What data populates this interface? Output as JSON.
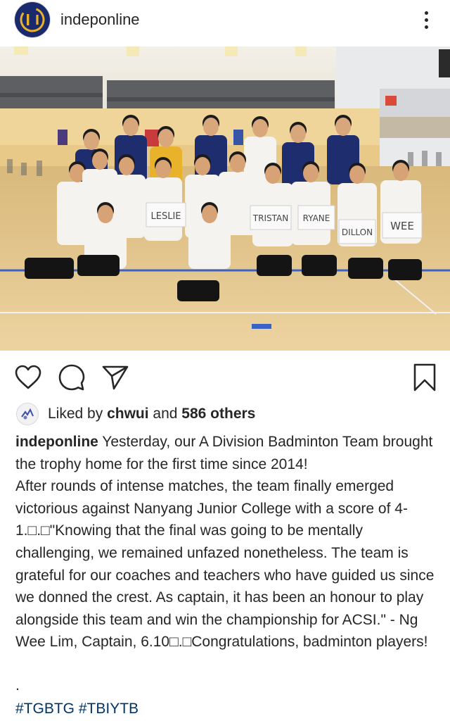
{
  "header": {
    "username": "indeponline",
    "avatar_icon": "indeponline-logo-icon",
    "more_icon": "more-options-icon"
  },
  "photo": {
    "signs": [
      "LESLIE",
      "TRISTAN",
      "RYANE",
      "DILLON",
      "WEE"
    ],
    "colors": {
      "floor": "#e2c48a",
      "wall": "#f0d79a",
      "jersey": "#f5f3ef",
      "polo": "#1e2d6e",
      "accent": "#e8b22a"
    }
  },
  "actions": {
    "like_icon": "heart-icon",
    "comment_icon": "comment-icon",
    "share_icon": "share-icon",
    "save_icon": "bookmark-icon"
  },
  "likes": {
    "prefix": "Liked by ",
    "user": "chwui",
    "middle": " and ",
    "others": "586 others"
  },
  "caption": {
    "username": "indeponline",
    "text": " Yesterday, our A Division Badminton Team brought the trophy home for the first time since 2014!\nAfter rounds of intense matches, the team finally emerged victorious against Nanyang Junior College with a score of 4-1.□.□\"Knowing that the final was going to be mentally challenging, we remained unfazed nonetheless. The team is grateful for our coaches and teachers who have guided us since we donned the crest. As captain, it has been an honour to play alongside this team and win the championship for ACSI.\" - Ng Wee Lim, Captain, 6.10□.□Congratulations, badminton players!",
    "separator": ".",
    "hashtags": [
      "#TGBTG",
      "#TBIYTB"
    ]
  }
}
